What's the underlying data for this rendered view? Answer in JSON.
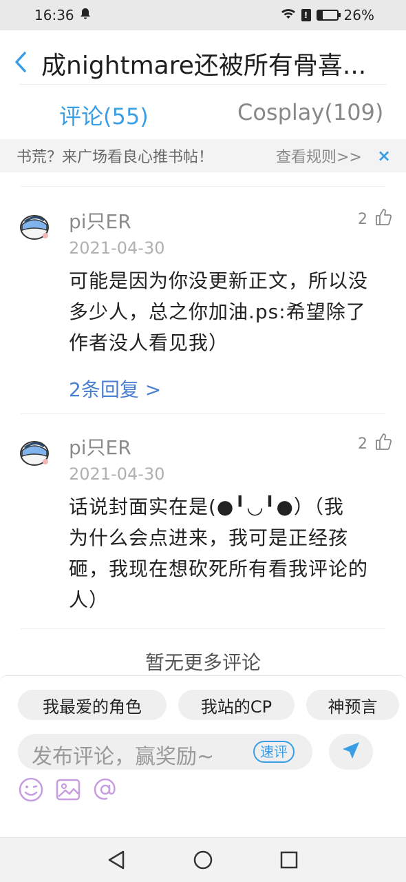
{
  "status": {
    "time": "16:36",
    "battery": "26%",
    "battery_level": 0.26
  },
  "header": {
    "title": "成nightmare还被所有骨喜..."
  },
  "tabs": [
    {
      "label": "评论(55)",
      "active": true
    },
    {
      "label": "Cosplay(109)",
      "active": false
    }
  ],
  "notice": {
    "text": "书荒？来广场看良心推书帖！",
    "link": "查看规则>>",
    "close": "×"
  },
  "comments": [
    {
      "user": "pi只ER",
      "likes": "2",
      "date": "2021-04-30",
      "lines": [
        "可能是因为你没更新正文，所以没",
        "多少人，总之你加油.ps:希望除了",
        "作者没人看见我）"
      ],
      "reply_link": "2条回复 >"
    },
    {
      "user": "pi只ER",
      "likes": "2",
      "date": "2021-04-30",
      "lines": [
        "话说封面实在是(●╹◡╹●）（我",
        "为什么会点进来，我可是正经孩",
        "砸，我现在想砍死所有看我评论的",
        "人）"
      ]
    }
  ],
  "no_more": "暂无更多评论",
  "chips": [
    "我最爱的角色",
    "我站的CP",
    "神预言"
  ],
  "input": {
    "placeholder": "发布评论，赢奖励~",
    "quick_label": "速评"
  },
  "colors": {
    "accent": "#3a9ee4",
    "tool_icon": "#c79de0"
  },
  "icons": [
    "back-icon",
    "send-icon",
    "emoji-icon",
    "image-icon",
    "mention-icon",
    "thumbs-up-icon",
    "nav-back-icon",
    "nav-home-icon",
    "nav-recents-icon"
  ]
}
